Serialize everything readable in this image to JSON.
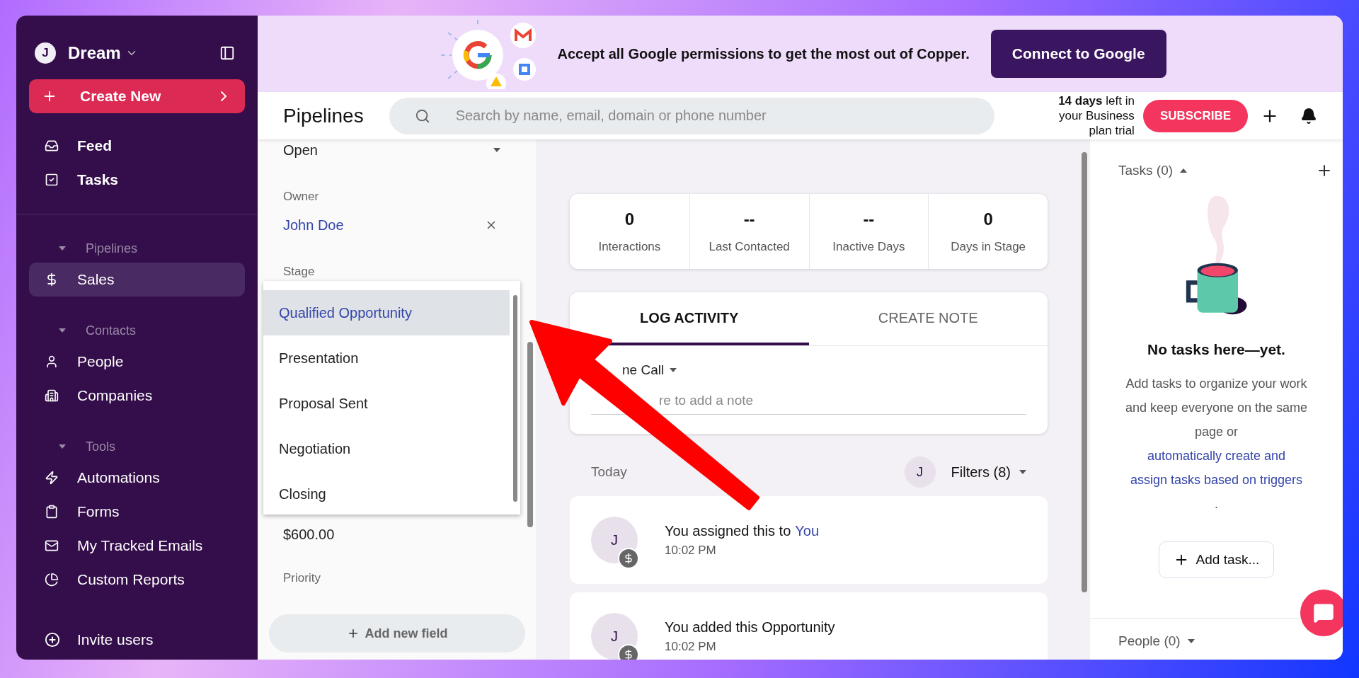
{
  "banner": {
    "message": "Accept all Google permissions to get the most out of Copper.",
    "button": "Connect to Google"
  },
  "sidebar": {
    "workspace": {
      "initial": "J",
      "name": "Dream"
    },
    "create_button": "Create New",
    "sections": [
      {
        "items": [
          {
            "label": "Feed",
            "selected": false
          },
          {
            "label": "Tasks",
            "selected": false
          }
        ]
      },
      {
        "heading": "Pipelines",
        "items": [
          {
            "label": "Sales",
            "selected": true
          }
        ]
      },
      {
        "heading": "Contacts",
        "items": [
          {
            "label": "People",
            "selected": false
          },
          {
            "label": "Companies",
            "selected": false
          }
        ]
      },
      {
        "heading": "Tools",
        "items": [
          {
            "label": "Automations",
            "selected": false
          },
          {
            "label": "Forms",
            "selected": false
          },
          {
            "label": "My Tracked Emails",
            "selected": false
          },
          {
            "label": "Custom Reports",
            "selected": false
          }
        ]
      }
    ],
    "footer_item": "Invite users"
  },
  "header": {
    "title": "Pipelines",
    "search": {
      "placeholder": "Search by name, email, domain or phone number"
    },
    "trial": "**14 days** left in your Business plan trial",
    "subscribe": "SUBSCRIBE"
  },
  "fields": {
    "status": "Open",
    "owner": {
      "label": "Owner",
      "value": "John Doe"
    },
    "stage": {
      "label": "Stage",
      "options": [
        {
          "label": "Qualified Opportunity",
          "selected": true
        },
        {
          "label": "Presentation",
          "selected": false
        },
        {
          "label": "Proposal Sent",
          "selected": false
        },
        {
          "label": "Negotiation",
          "selected": false
        },
        {
          "label": "Closing",
          "selected": false
        }
      ]
    },
    "value": "$600.00",
    "priority_label": "Priority",
    "add_field": "Add new field"
  },
  "stats": [
    {
      "value": "0",
      "label": "Interactions"
    },
    {
      "value": "--",
      "label": "Last Contacted"
    },
    {
      "value": "--",
      "label": "Inactive Days"
    },
    {
      "value": "0",
      "label": "Days in Stage"
    }
  ],
  "activity": {
    "tabs": [
      {
        "label": "LOG ACTIVITY",
        "selected": true
      },
      {
        "label": "CREATE NOTE",
        "selected": false
      }
    ],
    "type": "ne Call",
    "note_placeholder": "re to add a note"
  },
  "feed": {
    "date": "Today",
    "avatar": "J",
    "filters": "Filters (8)",
    "items": [
      {
        "avatar": "J",
        "text": "You assigned this to",
        "link": "You",
        "time": "10:02 PM"
      },
      {
        "avatar": "J",
        "text": "You added this Opportunity",
        "time": "10:02 PM"
      }
    ]
  },
  "tasks": {
    "title": "Tasks (0)",
    "empty_title": "No tasks here—yet.",
    "description": "Add tasks to organize your work and keep everyone on the same page or",
    "link": "automatically create and assign tasks based on triggers",
    "period": ".",
    "button": "Add task..."
  },
  "people": {
    "title": "People (0)"
  }
}
